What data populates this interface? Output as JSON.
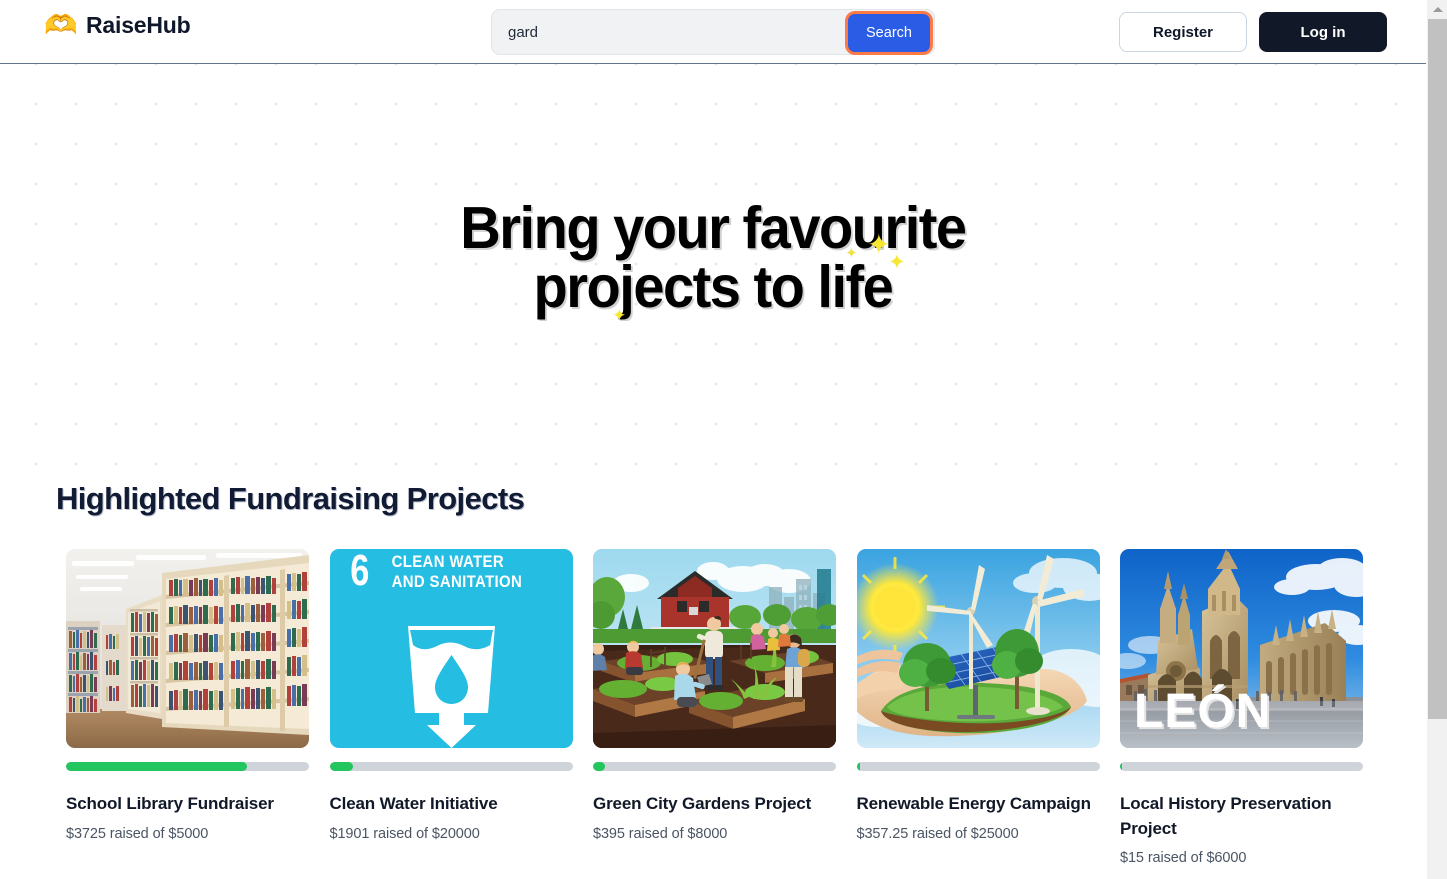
{
  "header": {
    "brand_icon": "heart-in-hand-icon",
    "brand_glyph": "🫶",
    "brand_name": "RaiseHub",
    "search": {
      "value": "gard",
      "placeholder": "",
      "button_label": "Search",
      "button_color": "#2b5ce6",
      "focus_ring_color": "#fb7a45"
    },
    "register_label": "Register",
    "login_label": "Log in",
    "login_bg": "#111827"
  },
  "hero": {
    "title_line1": "Bring your favourite",
    "title_line2": "projects to life",
    "sparkle_glyph": "✦",
    "sparkle_color": "#f7e733",
    "background": "dot-grid"
  },
  "projects_section": {
    "title": "Highlighted Fundraising Projects",
    "progress_color": "#22c55e",
    "track_color": "#cfd4da",
    "cards": [
      {
        "image_name": "library-bookshelves-photo",
        "title": "School Library Fundraiser",
        "raised_text": "$3725 raised of $5000",
        "raised": 3725,
        "goal": 5000,
        "percent": 74.5
      },
      {
        "image_name": "sdg6-clean-water-and-sanitation-graphic",
        "image_caption_number": "6",
        "image_caption_line1": "CLEAN WATER",
        "image_caption_line2": "AND SANITATION",
        "image_bg": "#26bde2",
        "title": "Clean Water Initiative",
        "raised_text": "$1901 raised of $20000",
        "raised": 1901,
        "goal": 20000,
        "percent": 9.5
      },
      {
        "image_name": "community-garden-illustration",
        "title": "Green City Gardens Project",
        "raised_text": "$395 raised of $8000",
        "raised": 395,
        "goal": 8000,
        "percent": 4.9
      },
      {
        "image_name": "renewable-energy-hand-photo",
        "title": "Renewable Energy Campaign",
        "raised_text": "$357.25 raised of $25000",
        "raised": 357.25,
        "goal": 25000,
        "percent": 1.4
      },
      {
        "image_name": "leon-cathedral-photo",
        "image_caption": "LEÓN",
        "title": "Local History Preservation Project",
        "raised_text": "$15 raised of $6000",
        "raised": 15,
        "goal": 6000,
        "percent": 0.25
      }
    ]
  },
  "scrollbar": {
    "up_arrow": "scroll-up-arrow",
    "thumb_color": "#c1c1c1"
  }
}
